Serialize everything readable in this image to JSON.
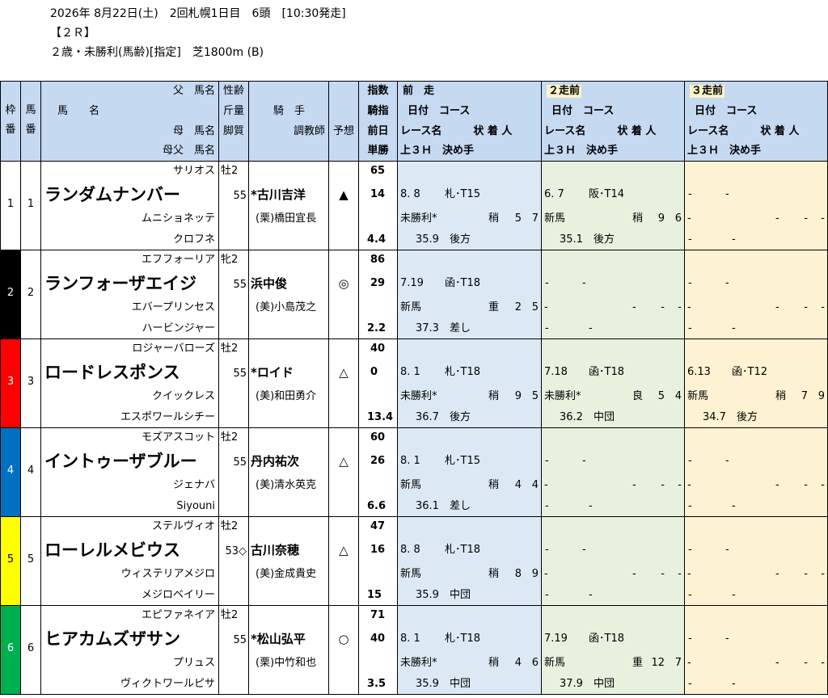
{
  "header": {
    "line1": "2026年 8月22日(土)　2回札幌1日目　6頭　[10:30発走]",
    "line2": "【２Ｒ】",
    "line3": "２歳・未勝利(馬齢)[指定]　芝1800m (B)"
  },
  "colhead": {
    "waku": [
      "枠",
      "番"
    ],
    "uma": [
      "馬",
      "番"
    ],
    "horse": [
      "父　馬名",
      "馬　　名",
      "母　馬名",
      "母父　馬名"
    ],
    "sei": [
      "性齢",
      "斤量",
      "脚質"
    ],
    "jockey": [
      "騎　手",
      "調教師"
    ],
    "yoso": "予想",
    "idx": [
      "指数",
      "騎指",
      "前日",
      "単勝"
    ],
    "prev1": [
      "前　走",
      "日付　コース",
      "レース名　　　状 着 人",
      "上３Ｈ　決め手"
    ],
    "prev2": [
      "２走前",
      "日付　コース",
      "レース名　　　状 着 人",
      "上３Ｈ　決め手"
    ],
    "prev3": [
      "３走前",
      "日付　コース",
      "レース名　　　状 着 人",
      "上３Ｈ　決め手"
    ]
  },
  "colors": {
    "header_bg": "#c5d9f1",
    "prev1_bg": "#dce9f5",
    "prev2_bg": "#e7f1de",
    "prev3_bg": "#fdf2d2"
  },
  "horses": [
    {
      "waku": "1",
      "uma": "1",
      "waku_color": "#ffffff",
      "waku_text": "#000000",
      "sire": "サリオス",
      "name": "ランダムナンバー",
      "dam": "ムニショネッテ",
      "damsire": "クロフネ",
      "sexage": "牡2",
      "weight": "55",
      "jockey": "*古川吉洋",
      "trainer": "(栗)橋田宜長",
      "mark": "▲",
      "idx": "65",
      "jidx": "14",
      "prev_day": "",
      "odds": "4.4",
      "p1": {
        "date": "8. 8",
        "course": "札･T15",
        "race": "未勝利*",
        "cond": "稍",
        "pos": "5",
        "pop": "7",
        "time": "35.9",
        "style": "後方"
      },
      "p2": {
        "date": "6. 7",
        "course": "阪･T14",
        "race": "新馬",
        "cond": "稍",
        "pos": "9",
        "pop": "6",
        "time": "35.1",
        "style": "後方"
      },
      "p3": {
        "date": "-",
        "course": "-",
        "race": "-",
        "cond": "-",
        "pos": "-",
        "pop": "-",
        "time": "-",
        "style": "-"
      }
    },
    {
      "waku": "2",
      "uma": "2",
      "waku_color": "#000000",
      "waku_text": "#ffffff",
      "sire": "エフフォーリア",
      "name": "ランフォーザエイジ",
      "dam": "エバープリンセス",
      "damsire": "ハービンジャー",
      "sexage": "牝2",
      "weight": "55",
      "jockey": "浜中俊",
      "trainer": "(美)小島茂之",
      "mark": "◎",
      "idx": "86",
      "jidx": "29",
      "prev_day": "",
      "odds": "2.2",
      "p1": {
        "date": "7.19",
        "course": "函･T18",
        "race": "新馬",
        "cond": "重",
        "pos": "2",
        "pop": "5",
        "time": "37.3",
        "style": "差し"
      },
      "p2": {
        "date": "-",
        "course": "-",
        "race": "-",
        "cond": "-",
        "pos": "-",
        "pop": "-",
        "time": "-",
        "style": "-"
      },
      "p3": {
        "date": "-",
        "course": "-",
        "race": "-",
        "cond": "-",
        "pos": "-",
        "pop": "-",
        "time": "-",
        "style": "-"
      }
    },
    {
      "waku": "3",
      "uma": "3",
      "waku_color": "#ff0000",
      "waku_text": "#ffffff",
      "sire": "ロジャーバローズ",
      "name": "ロードレスポンス",
      "dam": "クイックレス",
      "damsire": "エスポワールシチー",
      "sexage": "牡2",
      "weight": "55",
      "jockey": "*ロイド",
      "trainer": "(美)和田勇介",
      "mark": "△",
      "idx": "40",
      "jidx": "0",
      "prev_day": "",
      "odds": "13.4",
      "p1": {
        "date": "8. 1",
        "course": "札･T18",
        "race": "未勝利*",
        "cond": "稍",
        "pos": "9",
        "pop": "5",
        "time": "36.7",
        "style": "後方"
      },
      "p2": {
        "date": "7.18",
        "course": "函･T18",
        "race": "未勝利*",
        "cond": "良",
        "pos": "5",
        "pop": "4",
        "time": "36.2",
        "style": "中団"
      },
      "p3": {
        "date": "6.13",
        "course": "函･T12",
        "race": "新馬",
        "cond": "稍",
        "pos": "7",
        "pop": "9",
        "time": "34.7",
        "style": "後方"
      }
    },
    {
      "waku": "4",
      "uma": "4",
      "waku_color": "#0070c0",
      "waku_text": "#ffffff",
      "sire": "モズアスコット",
      "name": "イントゥーザブルー",
      "dam": "ジェナバ",
      "damsire": "Siyouni",
      "sexage": "牡2",
      "weight": "55",
      "jockey": "丹内祐次",
      "trainer": "(美)清水英克",
      "mark": "△",
      "idx": "60",
      "jidx": "26",
      "prev_day": "",
      "odds": "6.6",
      "p1": {
        "date": "8. 1",
        "course": "札･T15",
        "race": "新馬",
        "cond": "稍",
        "pos": "4",
        "pop": "4",
        "time": "36.1",
        "style": "差し"
      },
      "p2": {
        "date": "-",
        "course": "-",
        "race": "-",
        "cond": "-",
        "pos": "-",
        "pop": "-",
        "time": "-",
        "style": "-"
      },
      "p3": {
        "date": "-",
        "course": "-",
        "race": "-",
        "cond": "-",
        "pos": "-",
        "pop": "-",
        "time": "-",
        "style": "-"
      }
    },
    {
      "waku": "5",
      "uma": "5",
      "waku_color": "#ffff00",
      "waku_text": "#000000",
      "sire": "ステルヴィオ",
      "name": "ローレルメビウス",
      "dam": "ウィステリアメジロ",
      "damsire": "メジロベイリー",
      "sexage": "牡2",
      "weight": "53◇",
      "jockey": "古川奈穂",
      "trainer": "(美)金成貴史",
      "mark": "△",
      "idx": "47",
      "jidx": "16",
      "prev_day": "",
      "odds": "15",
      "p1": {
        "date": "8. 8",
        "course": "札･T18",
        "race": "新馬",
        "cond": "稍",
        "pos": "8",
        "pop": "9",
        "time": "35.9",
        "style": "中団"
      },
      "p2": {
        "date": "-",
        "course": "-",
        "race": "-",
        "cond": "-",
        "pos": "-",
        "pop": "-",
        "time": "-",
        "style": "-"
      },
      "p3": {
        "date": "-",
        "course": "-",
        "race": "-",
        "cond": "-",
        "pos": "-",
        "pop": "-",
        "time": "-",
        "style": "-"
      }
    },
    {
      "waku": "6",
      "uma": "6",
      "waku_color": "#00b050",
      "waku_text": "#ffffff",
      "sire": "エピファネイア",
      "name": "ヒアカムズザサン",
      "dam": "プリュス",
      "damsire": "ヴィクトワールピサ",
      "sexage": "牡2",
      "weight": "55",
      "jockey": "*松山弘平",
      "trainer": "(栗)中竹和也",
      "mark": "○",
      "idx": "71",
      "jidx": "40",
      "prev_day": "",
      "odds": "3.5",
      "p1": {
        "date": "8. 1",
        "course": "札･T18",
        "race": "未勝利*",
        "cond": "稍",
        "pos": "4",
        "pop": "6",
        "time": "35.9",
        "style": "中団"
      },
      "p2": {
        "date": "7.19",
        "course": "函･T18",
        "race": "新馬",
        "cond": "重",
        "pos": "12",
        "pop": "7",
        "time": "37.9",
        "style": "中団"
      },
      "p3": {
        "date": "-",
        "course": "-",
        "race": "-",
        "cond": "-",
        "pos": "-",
        "pop": "-",
        "time": "-",
        "style": "-"
      }
    }
  ]
}
